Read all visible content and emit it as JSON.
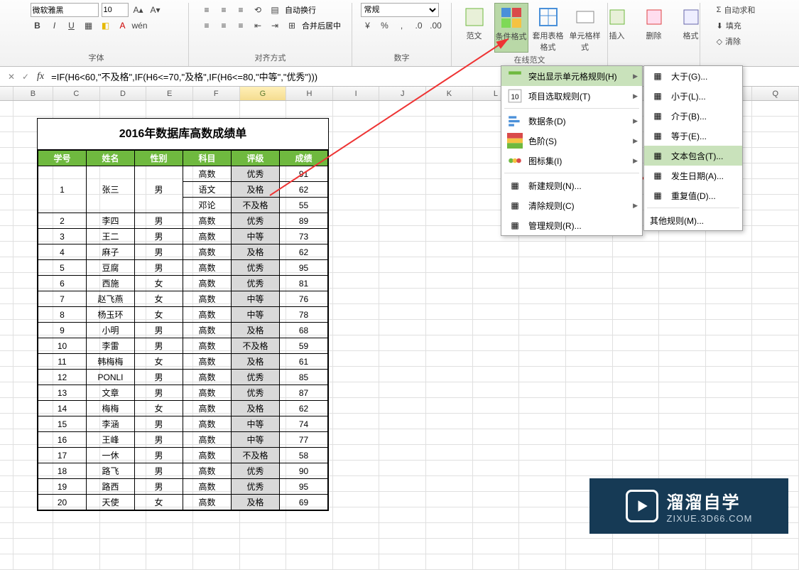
{
  "ribbon": {
    "font_name": "微软雅黑",
    "font_size": "10",
    "groups": {
      "font": "字体",
      "align": "对齐方式",
      "number": "数字",
      "styles": "在线范文"
    },
    "wrap_text": "自动换行",
    "merge_center": "合并后居中",
    "number_format": "常规",
    "styles_btn": {
      "template": "范文",
      "cond_format": "条件格式",
      "table_format": "套用表格格式",
      "cell_style": "单元格样式"
    },
    "cells": {
      "insert": "插入",
      "delete": "删除",
      "format": "格式"
    },
    "editing": {
      "autosum": "自动求和",
      "fill": "填充",
      "clear": "清除"
    }
  },
  "formula_bar": {
    "formula": "=IF(H6<60,\"不及格\",IF(H6<=70,\"及格\",IF(H6<=80,\"中等\",\"优秀\")))"
  },
  "columns": [
    "",
    "B",
    "C",
    "D",
    "E",
    "F",
    "G",
    "H",
    "I",
    "J",
    "K",
    "L",
    "",
    "",
    "",
    "",
    "",
    "Q"
  ],
  "table": {
    "title": "2016年数据库高数成绩单",
    "headers": [
      "学号",
      "姓名",
      "性别",
      "科目",
      "评级",
      "成绩"
    ],
    "merged_rows": [
      {
        "id": "1",
        "name": "张三",
        "gender": "男",
        "subjects": [
          {
            "subject": "高数",
            "grade": "优秀",
            "score": "91"
          },
          {
            "subject": "语文",
            "grade": "及格",
            "score": "62"
          },
          {
            "subject": "邓论",
            "grade": "不及格",
            "score": "55"
          }
        ]
      }
    ],
    "rows": [
      {
        "id": "2",
        "name": "李四",
        "gender": "男",
        "subject": "高数",
        "grade": "优秀",
        "score": "89"
      },
      {
        "id": "3",
        "name": "王二",
        "gender": "男",
        "subject": "高数",
        "grade": "中等",
        "score": "73"
      },
      {
        "id": "4",
        "name": "麻子",
        "gender": "男",
        "subject": "高数",
        "grade": "及格",
        "score": "62"
      },
      {
        "id": "5",
        "name": "豆腐",
        "gender": "男",
        "subject": "高数",
        "grade": "优秀",
        "score": "95"
      },
      {
        "id": "6",
        "name": "西施",
        "gender": "女",
        "subject": "高数",
        "grade": "优秀",
        "score": "81"
      },
      {
        "id": "7",
        "name": "赵飞燕",
        "gender": "女",
        "subject": "高数",
        "grade": "中等",
        "score": "76"
      },
      {
        "id": "8",
        "name": "杨玉环",
        "gender": "女",
        "subject": "高数",
        "grade": "中等",
        "score": "78"
      },
      {
        "id": "9",
        "name": "小明",
        "gender": "男",
        "subject": "高数",
        "grade": "及格",
        "score": "68"
      },
      {
        "id": "10",
        "name": "李雷",
        "gender": "男",
        "subject": "高数",
        "grade": "不及格",
        "score": "59"
      },
      {
        "id": "11",
        "name": "韩梅梅",
        "gender": "女",
        "subject": "高数",
        "grade": "及格",
        "score": "61"
      },
      {
        "id": "12",
        "name": "PONLI",
        "gender": "男",
        "subject": "高数",
        "grade": "优秀",
        "score": "85"
      },
      {
        "id": "13",
        "name": "文章",
        "gender": "男",
        "subject": "高数",
        "grade": "优秀",
        "score": "87"
      },
      {
        "id": "14",
        "name": "梅梅",
        "gender": "女",
        "subject": "高数",
        "grade": "及格",
        "score": "62"
      },
      {
        "id": "15",
        "name": "李涵",
        "gender": "男",
        "subject": "高数",
        "grade": "中等",
        "score": "74"
      },
      {
        "id": "16",
        "name": "王峰",
        "gender": "男",
        "subject": "高数",
        "grade": "中等",
        "score": "77"
      },
      {
        "id": "17",
        "name": "一休",
        "gender": "男",
        "subject": "高数",
        "grade": "不及格",
        "score": "58"
      },
      {
        "id": "18",
        "name": "路飞",
        "gender": "男",
        "subject": "高数",
        "grade": "优秀",
        "score": "90"
      },
      {
        "id": "19",
        "name": "路西",
        "gender": "男",
        "subject": "高数",
        "grade": "优秀",
        "score": "95"
      },
      {
        "id": "20",
        "name": "天使",
        "gender": "女",
        "subject": "高数",
        "grade": "及格",
        "score": "69"
      }
    ]
  },
  "menu1": {
    "highlight_rules": "突出显示单元格规则(H)",
    "top_bottom": "项目选取规则(T)",
    "data_bars": "数据条(D)",
    "color_scales": "色阶(S)",
    "icon_sets": "图标集(I)",
    "new_rule": "新建规则(N)...",
    "clear_rules": "清除规则(C)",
    "manage_rules": "管理规则(R)..."
  },
  "menu2": {
    "greater": "大于(G)...",
    "less": "小于(L)...",
    "between": "介于(B)...",
    "equal": "等于(E)...",
    "text_contains": "文本包含(T)...",
    "date": "发生日期(A)...",
    "duplicate": "重复值(D)...",
    "other": "其他规则(M)..."
  },
  "watermark": {
    "line1": "溜溜自学",
    "line2": "ZIXUE.3D66.COM"
  }
}
